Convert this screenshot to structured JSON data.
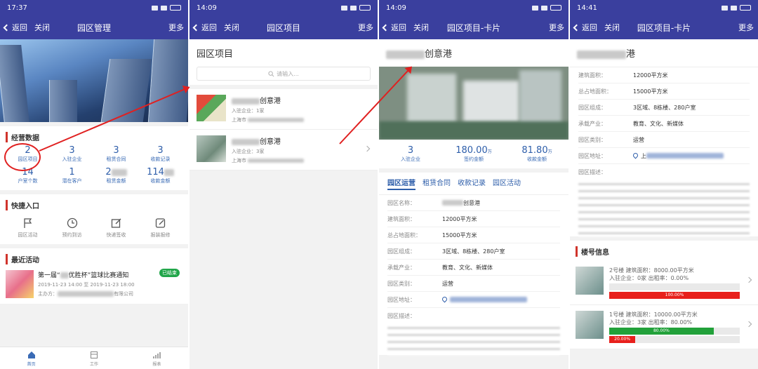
{
  "screen1": {
    "time": "17:37",
    "nav": {
      "back": "返回",
      "close": "关闭",
      "title": "园区管理",
      "more": "更多"
    },
    "ops_title": "经营数据",
    "stats": [
      {
        "value": "2",
        "label": "园区项目"
      },
      {
        "value": "3",
        "label": "入驻企业"
      },
      {
        "value": "3",
        "label": "租赁合同"
      },
      {
        "value": "3",
        "label": "收款记录"
      },
      {
        "value": "14",
        "label": "户室个数"
      },
      {
        "value": "1",
        "label": "潜在客户"
      },
      {
        "value": "2",
        "label": "租赁金额"
      },
      {
        "value": "114",
        "label": "收款金额"
      }
    ],
    "quick_title": "快捷入口",
    "quick": [
      {
        "label": "园区活动",
        "icon": "flag-icon"
      },
      {
        "label": "预约到访",
        "icon": "clock-icon"
      },
      {
        "label": "快递签收",
        "icon": "edit-icon"
      },
      {
        "label": "报装报修",
        "icon": "edit-square-icon"
      }
    ],
    "recent_title": "最近活动",
    "activity": {
      "title": "第一届“",
      "title_end": "优胜杯”篮球比赛通知",
      "status": "已结束",
      "time": "2019-11-23 14:00 至 2019-11-23 18:00",
      "organizer_prefix": "主办方：",
      "organizer_suffix": "有限公司"
    },
    "tabs": [
      {
        "label": "首页"
      },
      {
        "label": "工作"
      },
      {
        "label": "报表"
      }
    ]
  },
  "screen2": {
    "time": "14:09",
    "nav": {
      "back": "返回",
      "close": "关闭",
      "title": "园区项目",
      "more": "更多"
    },
    "heading": "园区项目",
    "search_placeholder": "请输入...",
    "items": [
      {
        "name": "创意港",
        "companies": "入驻企业：1家",
        "city": "上海市"
      },
      {
        "name": "创意港",
        "companies": "入驻企业：3家",
        "city": "上海市"
      }
    ]
  },
  "screen3": {
    "time": "14:09",
    "nav": {
      "back": "返回",
      "close": "关闭",
      "title": "园区项目-卡片",
      "more": "更多"
    },
    "heading": "创意港",
    "stats": [
      {
        "value": "3",
        "unit": "",
        "label": "入驻企业"
      },
      {
        "value": "180.00",
        "unit": "万",
        "label": "签约金额"
      },
      {
        "value": "81.80",
        "unit": "万",
        "label": "收款金额"
      }
    ],
    "tabs": [
      "园区运营",
      "租赁合同",
      "收款记录",
      "园区活动"
    ],
    "fields": [
      {
        "k": "园区名称：",
        "v": "创意港"
      },
      {
        "k": "建筑面积：",
        "v": "12000平方米"
      },
      {
        "k": "总占地面积：",
        "v": "15000平方米"
      },
      {
        "k": "园区组成：",
        "v": "3区域、8栋楼、280户室"
      },
      {
        "k": "承载产业：",
        "v": "教育、文化、新媒体"
      },
      {
        "k": "园区类别：",
        "v": "运营"
      },
      {
        "k": "园区地址：",
        "v": ""
      },
      {
        "k": "园区描述：",
        "v": ""
      }
    ]
  },
  "screen4": {
    "time": "14:41",
    "nav": {
      "back": "返回",
      "close": "关闭",
      "title": "园区项目-卡片",
      "more": "更多"
    },
    "heading": "港",
    "fields": [
      {
        "k": "建筑面积：",
        "v": "12000平方米"
      },
      {
        "k": "总占地面积：",
        "v": "15000平方米"
      },
      {
        "k": "园区组成：",
        "v": "3区域、8栋楼、280户室"
      },
      {
        "k": "承载产业：",
        "v": "教育、文化、新媒体"
      },
      {
        "k": "园区类别：",
        "v": "运营"
      },
      {
        "k": "园区地址：",
        "v": "上"
      },
      {
        "k": "园区描述：",
        "v": ""
      }
    ],
    "building_title": "楼号信息",
    "buildings": [
      {
        "line1": "2号楼  建筑面积：8000.00平方米",
        "line2": "入驻企业：0家  出租率：0.00%",
        "vacancy_pct": 100,
        "vacancy_label": "100.00%",
        "occupancy_pct": 0,
        "occupancy_label": ""
      },
      {
        "line1": "1号楼  建筑面积：10000.00平方米",
        "line2": "入驻企业：3家  出租率：80.00%",
        "vacancy_pct": 20,
        "vacancy_label": "20.00%",
        "occupancy_pct": 80,
        "occupancy_label": "80.00%"
      }
    ],
    "colors": {
      "occupied": "#22a13a",
      "vacant": "#e8201c"
    }
  }
}
